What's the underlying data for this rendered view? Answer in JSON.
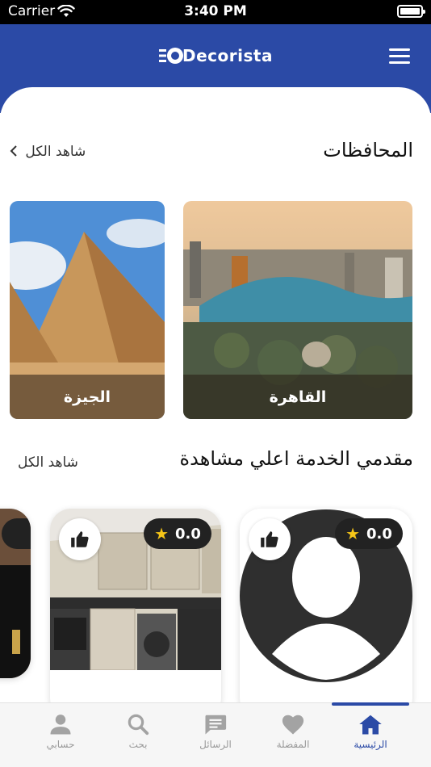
{
  "status_bar": {
    "carrier": "Carrier",
    "time": "3:40 PM"
  },
  "header": {
    "logo_text": "Decorista",
    "logo_mark": "E"
  },
  "governorates": {
    "title": "المحافظات",
    "see_all": "شاهد الكل",
    "items": [
      {
        "label": "القاهرة"
      },
      {
        "label": "الجيزة"
      }
    ]
  },
  "top_providers": {
    "title": "مقدمي الخدمة  اعلي مشاهدة",
    "see_all": "شاهد الكل",
    "items": [
      {
        "rating": "0.0"
      },
      {
        "rating": "0.0"
      }
    ]
  },
  "tabbar": {
    "tabs": [
      {
        "label": "الرئيسية",
        "icon": "home-icon",
        "active": true
      },
      {
        "label": "المفضلة",
        "icon": "heart-icon",
        "active": false
      },
      {
        "label": "الرسائل",
        "icon": "chat-icon",
        "active": false
      },
      {
        "label": "بحث",
        "icon": "search-icon",
        "active": false
      },
      {
        "label": "حسابي",
        "icon": "person-icon",
        "active": false
      }
    ]
  },
  "colors": {
    "primary": "#2b4aa6",
    "rating_star": "#f5c518"
  }
}
